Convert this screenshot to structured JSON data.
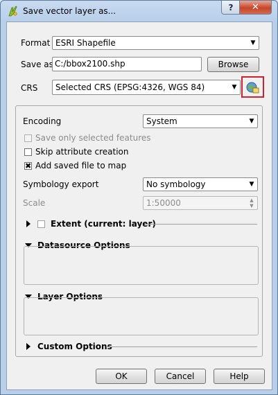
{
  "window": {
    "title": "Save vector layer as...",
    "help_label": "?",
    "close_label": "✕"
  },
  "format": {
    "label": "Format",
    "value": "ESRI Shapefile"
  },
  "save_as": {
    "label": "Save as",
    "value": "C:/bbox2100.shp",
    "browse_label": "Browse"
  },
  "crs": {
    "label": "CRS",
    "value": "Selected CRS (EPSG:4326, WGS 84)"
  },
  "encoding": {
    "label": "Encoding",
    "value": "System"
  },
  "options": {
    "save_selected": "Save only selected features",
    "skip_attr": "Skip attribute creation",
    "add_to_map": "Add saved file to map"
  },
  "symbology": {
    "label": "Symbology export",
    "value": "No symbology"
  },
  "scale": {
    "label": "Scale",
    "value": "1:50000"
  },
  "sections": {
    "extent": "Extent (current: layer)",
    "datasource": "Datasource Options",
    "layer": "Layer Options",
    "custom": "Custom Options"
  },
  "buttons": {
    "ok": "OK",
    "cancel": "Cancel",
    "help": "Help"
  },
  "colors": {
    "highlight": "#d0202a",
    "close": "#c7452b"
  }
}
